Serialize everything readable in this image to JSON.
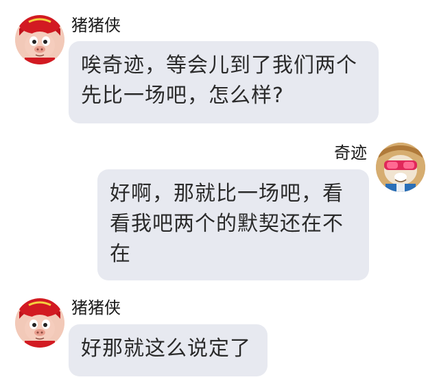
{
  "messages": [
    {
      "sender": "猪猪侠",
      "side": "left",
      "avatar_icon": "pig-hero-avatar-icon",
      "text": "唉奇迹，等会儿到了我们两个先比一场吧，怎么样?"
    },
    {
      "sender": "奇迹",
      "side": "right",
      "avatar_icon": "goggles-character-avatar-icon",
      "text": "好啊，那就比一场吧，看看我吧两个的默契还在不在"
    },
    {
      "sender": "猪猪侠",
      "side": "left",
      "avatar_icon": "pig-hero-avatar-icon",
      "text": "好那就这么说定了"
    }
  ],
  "colors": {
    "bubble": "#e7e9f0",
    "text": "#2a2a2a",
    "background": "#ffffff"
  }
}
